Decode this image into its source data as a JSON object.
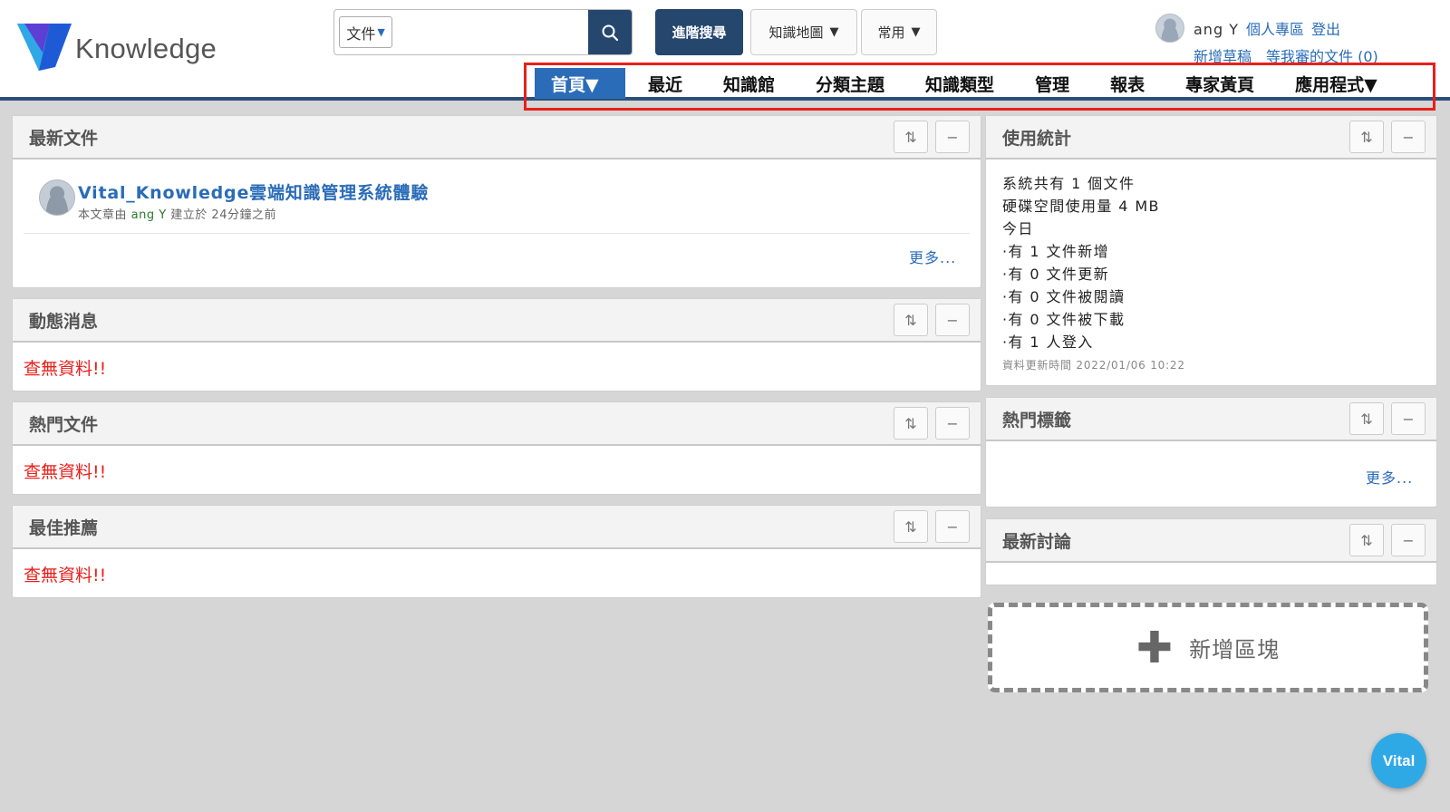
{
  "app": {
    "logo_text": "Knowledge"
  },
  "search": {
    "scope_value": "文件",
    "input_value": "",
    "search_icon": "search-icon"
  },
  "toolbar": {
    "advanced_search": "進階搜尋",
    "knowledge_map": "知識地圖",
    "common": "常用"
  },
  "user": {
    "name": "ang Y",
    "personal": "個人專區",
    "logout": "登出",
    "drafts": "新增草稿",
    "pending_review": "等我審的文件 (0)"
  },
  "nav": {
    "items": [
      {
        "label": "首頁▼",
        "active": true
      },
      {
        "label": "最近"
      },
      {
        "label": "知識館"
      },
      {
        "label": "分類主題"
      },
      {
        "label": "知識類型"
      },
      {
        "label": "管理"
      },
      {
        "label": "報表"
      },
      {
        "label": "專家黃頁"
      },
      {
        "label": "應用程式▼"
      }
    ]
  },
  "panels": {
    "latest_docs": {
      "title": "最新文件",
      "doc_title": "Vital_Knowledge雲端知識管理系統體驗",
      "meta_prefix": "本文章由 ",
      "meta_author": "ang Y",
      "meta_suffix": " 建立於 24分鐘之前",
      "more": "更多..."
    },
    "news": {
      "title": "動態消息",
      "empty": "查無資料!!"
    },
    "hot_docs": {
      "title": "熱門文件",
      "empty": "查無資料!!"
    },
    "best": {
      "title": "最佳推薦",
      "empty": "查無資料!!"
    },
    "usage": {
      "title": "使用統計",
      "lines": [
        "系統共有 1 個文件",
        "硬碟空間使用量 4 MB",
        "今日",
        "·有 1 文件新增",
        "·有 0 文件更新",
        "·有 0 文件被閱讀",
        "·有 0 文件被下載",
        "·有 1 人登入"
      ],
      "updated": "資料更新時間 2022/01/06 10:22"
    },
    "hot_tags": {
      "title": "熱門標籤",
      "more": "更多..."
    },
    "latest_discussion": {
      "title": "最新討論"
    }
  },
  "add_block": {
    "label": "新增區塊"
  },
  "fab": {
    "label": "Vital"
  },
  "colors": {
    "primary": "#25476e",
    "link": "#2a6cb8",
    "highlight": "#e8201b",
    "background": "#d6d6d6"
  }
}
